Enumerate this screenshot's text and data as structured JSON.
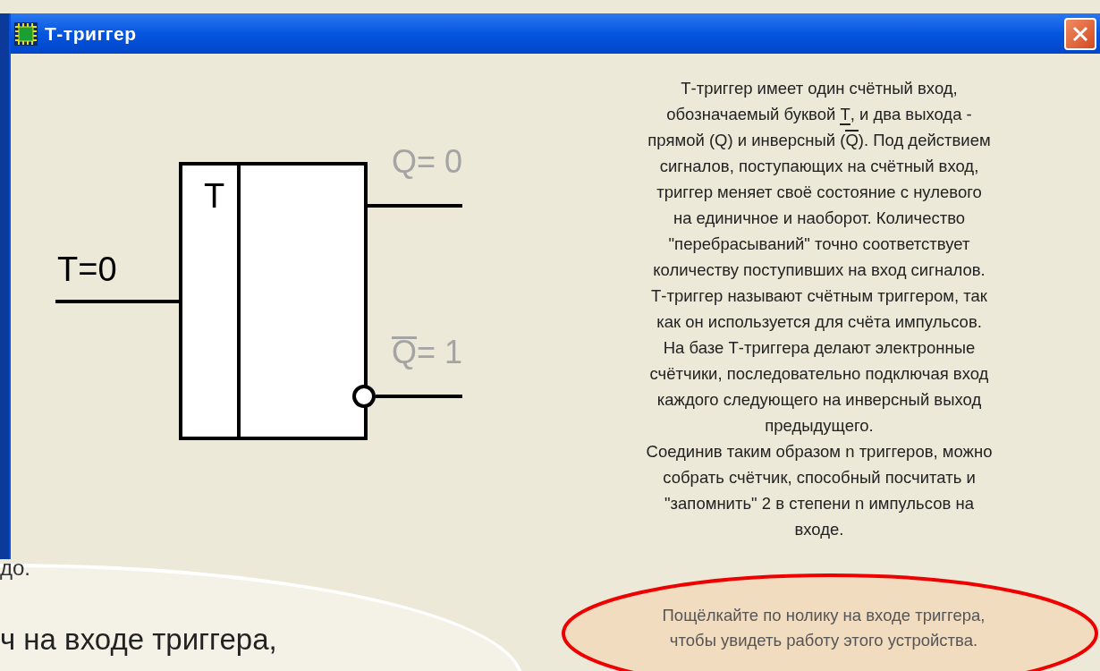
{
  "window": {
    "title": "Т-триггер"
  },
  "diagram": {
    "input_label": "T=0",
    "input_active": true,
    "block_label": "T",
    "outputs": [
      {
        "name": "Q",
        "value_text": "= 0",
        "inverted": false,
        "active": false
      },
      {
        "name": "Q",
        "value_text": "= 1",
        "inverted": true,
        "active": false
      }
    ]
  },
  "description": [
    {
      "parts": [
        {
          "text": "Т-триггер имеет один счётный вход,"
        }
      ]
    },
    {
      "parts": [
        {
          "text": "обозначаемый буквой "
        },
        {
          "text": "T",
          "underlined": true
        },
        {
          "text": ", и два выхода -"
        }
      ]
    },
    {
      "parts": [
        {
          "text": "прямой (Q) и инверсный ("
        },
        {
          "text": "Q",
          "overlined": true
        },
        {
          "text": "). Под действием"
        }
      ]
    },
    {
      "parts": [
        {
          "text": "сигналов, поступающих на счётный вход,"
        }
      ]
    },
    {
      "parts": [
        {
          "text": "триггер меняет своё состояние с нулевого"
        }
      ]
    },
    {
      "parts": [
        {
          "text": "на единичное и наоборот. Количество"
        }
      ]
    },
    {
      "parts": [
        {
          "text": "\"перебрасываний\" точно соответствует"
        }
      ]
    },
    {
      "parts": [
        {
          "text": "количеству поступивших на вход сигналов."
        }
      ]
    },
    {
      "parts": [
        {
          "text": "Т-триггер называют счётным триггером, так"
        }
      ]
    },
    {
      "parts": [
        {
          "text": "как он используется для счёта импульсов."
        }
      ]
    },
    {
      "parts": [
        {
          "text": "На базе Т-триггера делают электронные"
        }
      ]
    },
    {
      "parts": [
        {
          "text": "счётчики, последовательно подключая вход"
        }
      ]
    },
    {
      "parts": [
        {
          "text": "каждого следующего на инверсный выход"
        }
      ]
    },
    {
      "parts": [
        {
          "text": "предыдущего."
        }
      ]
    },
    {
      "parts": [
        {
          "text": "Соединив таким образом n триггеров, можно"
        }
      ]
    },
    {
      "parts": [
        {
          "text": "собрать счётчик, способный посчитать и"
        }
      ]
    },
    {
      "parts": [
        {
          "text": "\"запомнить\" 2 в степени n импульсов на"
        }
      ]
    },
    {
      "parts": [
        {
          "text": "входе."
        }
      ]
    }
  ],
  "hint": [
    "Пощёлкайте по нолику на входе триггера,",
    "чтобы увидеть работу этого устройства."
  ],
  "slide": {
    "fragment_top": "до.",
    "bubble_text": "ч на входе триггера,"
  }
}
